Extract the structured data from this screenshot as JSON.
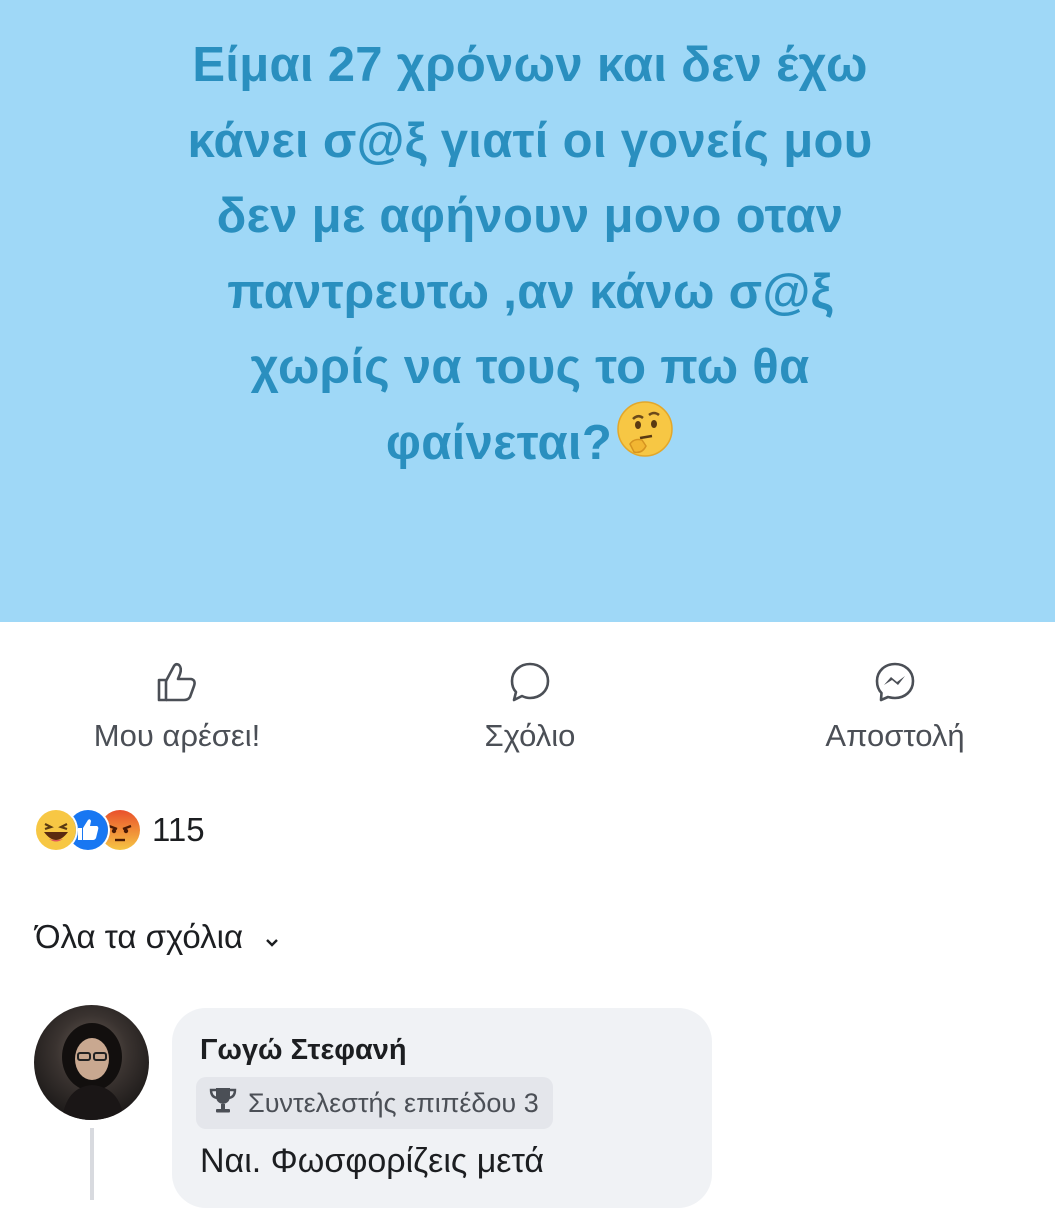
{
  "post": {
    "lines": [
      "Είμαι 27 χρόνων και δεν έχω",
      "κάνει σ@ξ γιατί οι γονείς μου",
      "δεν με αφήνουν μονο οταν",
      "παντρευτω ,αν κάνω σ@ξ",
      "χωρίς να τους το πω θα",
      "φαίνεται?"
    ],
    "emoji": "thinking-face"
  },
  "actions": {
    "like_label": "Μου αρέσει!",
    "comment_label": "Σχόλιο",
    "send_label": "Αποστολή"
  },
  "reactions": {
    "icons": [
      "laughing-face",
      "like-thumb",
      "angry-face"
    ],
    "count": "115"
  },
  "comments": {
    "filter_label": "Όλα τα σχόλια",
    "items": [
      {
        "author": "Γωγώ Στεφανή",
        "badge": "Συντελεστής επιπέδου 3",
        "text": "Ναι. Φωσφορίζεις μετά"
      }
    ]
  },
  "colors": {
    "post_background": "#9fd8f7",
    "post_text": "#2a8fbf",
    "like_blue": "#1877f2",
    "angry_orange": "#e9710f"
  }
}
